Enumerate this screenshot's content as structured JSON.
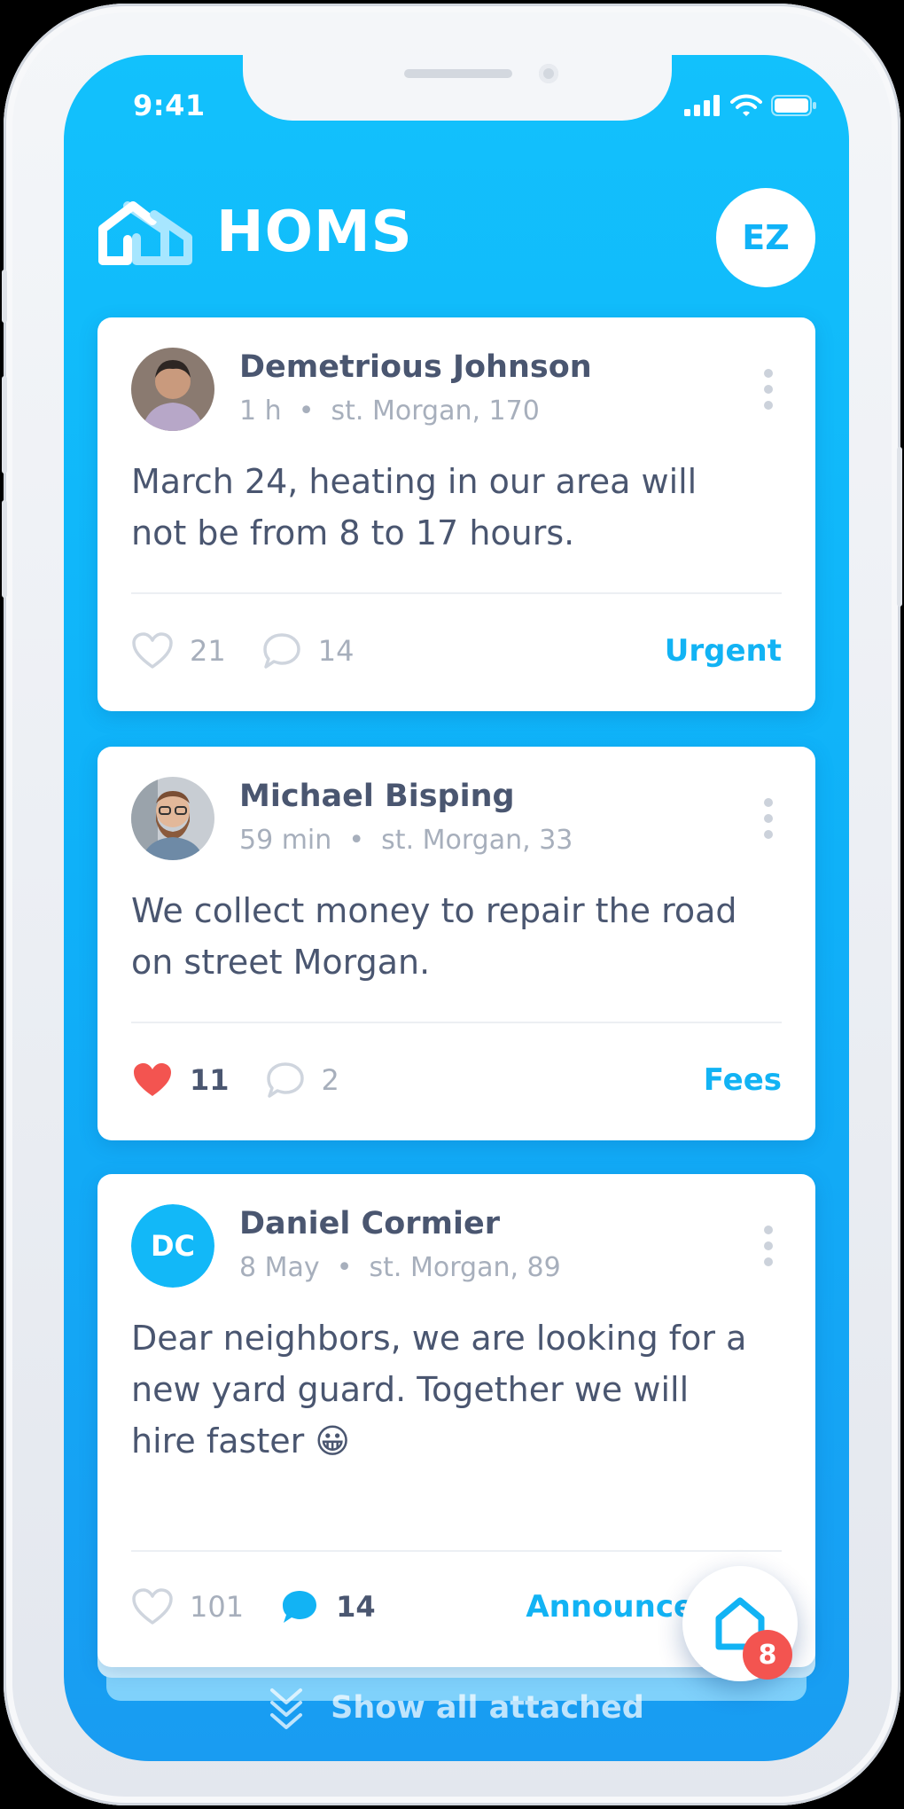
{
  "status_bar": {
    "time": "9:41"
  },
  "header": {
    "app_name": "HOMS",
    "user_initials": "EZ"
  },
  "posts": [
    {
      "author": "Demetrious Johnson",
      "time": "1 h",
      "address": "st. Morgan, 170",
      "text": "March 24, heating in our area will\nnot be from 8 to 17 hours.",
      "likes": "21",
      "comments": "14",
      "category": "Urgent",
      "liked": false,
      "commented": false
    },
    {
      "author": "Michael Bisping",
      "time": "59 min",
      "address": "st. Morgan, 33",
      "text": "We collect money to repair the road\non street Morgan.",
      "likes": "11",
      "comments": "2",
      "category": "Fees",
      "liked": true,
      "commented": false
    },
    {
      "author": "Daniel Cormier",
      "initials": "DC",
      "time": "8 May",
      "address": "st. Morgan, 89",
      "text": "Dear neighbors, we are looking for a\nnew yard guard. Together we will\nhire faster 😀",
      "likes": "101",
      "comments": "14",
      "category": "Announcement",
      "liked": false,
      "commented": true
    }
  ],
  "fab": {
    "badge": "8"
  },
  "show_all": {
    "label": "Show all attached"
  },
  "colors": {
    "accent": "#12b3f4",
    "like_active": "#f35450",
    "text_dark": "#4a5670",
    "text_muted": "#a7afbc"
  },
  "icons": {
    "logo": "house-logo-icon",
    "more": "more-vertical-icon",
    "like": "heart-icon",
    "comment": "comment-bubble-icon",
    "fab": "home-icon",
    "show_all": "double-chevron-down-icon"
  }
}
